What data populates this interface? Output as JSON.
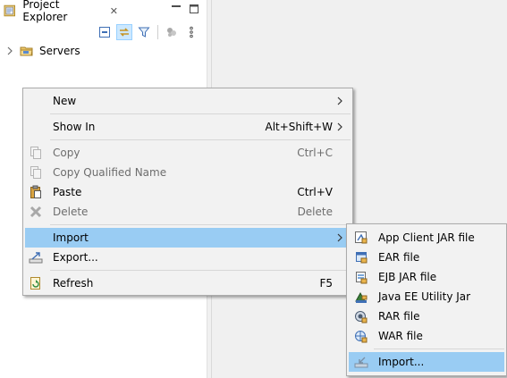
{
  "view": {
    "tab_label": "Project Explorer",
    "tab_close": "✕"
  },
  "tree": {
    "items": [
      {
        "label": "Servers"
      }
    ]
  },
  "context_menu": {
    "items": [
      {
        "label": "New",
        "shortcut": "",
        "has_submenu": true
      },
      {
        "label": "Show In",
        "shortcut": "Alt+Shift+W",
        "has_submenu": true
      },
      {
        "label": "Copy",
        "shortcut": "Ctrl+C",
        "disabled": true
      },
      {
        "label": "Copy Qualified Name",
        "shortcut": "",
        "disabled": true
      },
      {
        "label": "Paste",
        "shortcut": "Ctrl+V"
      },
      {
        "label": "Delete",
        "shortcut": "Delete",
        "disabled": true
      },
      {
        "label": "Import",
        "shortcut": "",
        "has_submenu": true,
        "selected": true
      },
      {
        "label": "Export...",
        "shortcut": ""
      },
      {
        "label": "Refresh",
        "shortcut": "F5"
      }
    ]
  },
  "import_submenu": {
    "items": [
      {
        "label": "App Client JAR file"
      },
      {
        "label": "EAR file"
      },
      {
        "label": "EJB JAR file"
      },
      {
        "label": "Java EE Utility Jar"
      },
      {
        "label": "RAR file"
      },
      {
        "label": "WAR file"
      },
      {
        "label": "Import...",
        "selected": true
      }
    ]
  },
  "icons": {
    "tab": "project-explorer-icon",
    "collapse": "collapse-all-icon",
    "link": "link-with-editor-icon",
    "filter": "filter-icon",
    "focus": "focus-icon",
    "menu": "view-menu-icon",
    "minimize": "minimize-icon",
    "maximize": "maximize-icon"
  },
  "colors": {
    "selection": "#99ccf3",
    "menu_bg": "#f2f2f2",
    "editor_bg": "#f0f0f0"
  }
}
